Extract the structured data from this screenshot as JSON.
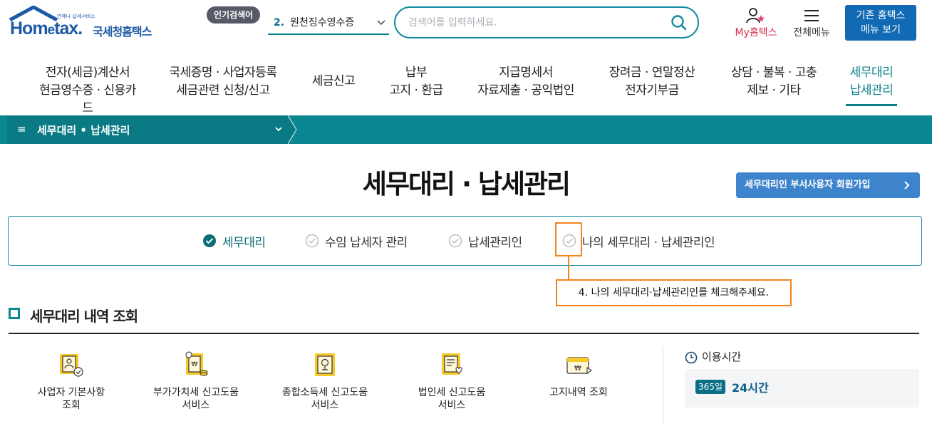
{
  "header": {
    "logo_small": "언제나 납세서비스",
    "logo_word_left": "Hom",
    "logo_word_e": "e",
    "logo_word_right": "tax.",
    "logo_kr": "국세청홈택스",
    "popular_badge": "인기검색어",
    "popular_rank": "2.",
    "popular_term": "원천징수영수증",
    "search_placeholder": "검색어를 입력하세요.",
    "my_label": "My홈택스",
    "menu_all_label": "전체메뉴",
    "old_menu_line1": "기존 홈택스",
    "old_menu_line2": "메뉴 보기"
  },
  "gnb": [
    {
      "line1": "전자(세금)계산서",
      "line2": "현금영수증 · 신용카드"
    },
    {
      "line1": "국세증명 · 사업자등록",
      "line2": "세금관련 신청/신고"
    },
    {
      "line1": "세금신고",
      "line2": ""
    },
    {
      "line1": "납부",
      "line2": "고지 · 환급"
    },
    {
      "line1": "지급명세서",
      "line2": "자료제출 · 공익법인"
    },
    {
      "line1": "장려금 · 연말정산",
      "line2": "전자기부금"
    },
    {
      "line1": "상담 · 불복 · 고충",
      "line2": "제보 · 기타"
    },
    {
      "line1": "세무대리",
      "line2": "납세관리"
    }
  ],
  "breadcrumb": {
    "menu_icon": "≡",
    "title": "세무대리 • 납세관리"
  },
  "page": {
    "title": "세무대리 · 납세관리",
    "join_button": "세무대리인 부서사용자 회원가입"
  },
  "tabs": [
    {
      "label": "세무대리",
      "checked": true
    },
    {
      "label": "수임 납세자 관리",
      "checked": false
    },
    {
      "label": "납세관리인",
      "checked": false
    },
    {
      "label": "나의 세무대리 · 납세관리인",
      "checked": false
    }
  ],
  "callout": "4. 나의 세무대리·납세관리인를 체크해주세요.",
  "section": {
    "title": "세무대리 내역 조회",
    "services": [
      {
        "line1": "사업자 기본사항",
        "line2": "조회",
        "icon": "business-doc-icon"
      },
      {
        "line1": "부가가치세 신고도움",
        "line2": "서비스",
        "icon": "vat-doc-icon"
      },
      {
        "line1": "종합소득세 신고도움",
        "line2": "서비스",
        "icon": "income-tax-doc-icon"
      },
      {
        "line1": "법인세 신고도움",
        "line2": "서비스",
        "icon": "corp-tax-doc-icon"
      },
      {
        "line1": "고지내역 조회",
        "line2": "",
        "icon": "notice-bill-icon"
      }
    ],
    "usage_title": "이용시간",
    "usage_badge": "365일",
    "usage_value": "24시간"
  },
  "colors": {
    "teal": "#0b8791",
    "accent_orange": "#f2851f",
    "brand_blue": "#1f5aa6",
    "button_blue": "#1269b4"
  }
}
